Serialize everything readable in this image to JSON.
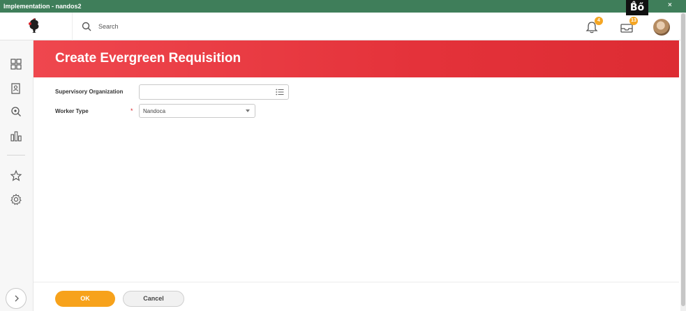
{
  "window": {
    "title": "Implementation - nandos2",
    "close_glyph": "×",
    "overlay_badge": "B̊ő"
  },
  "header": {
    "search_placeholder": "Search",
    "notifications": {
      "icon": "bell-icon",
      "count": "4"
    },
    "inbox": {
      "icon": "inbox-icon",
      "count": "13"
    },
    "avatar": "user-avatar"
  },
  "sidebar": {
    "items": [
      {
        "icon": "apps-grid-icon"
      },
      {
        "icon": "profile-card-icon"
      },
      {
        "icon": "search-zoom-icon"
      },
      {
        "icon": "bar-chart-icon"
      },
      {
        "icon": "star-icon"
      },
      {
        "icon": "gear-icon"
      }
    ],
    "expand_icon": "chevron-right-icon"
  },
  "page": {
    "title": "Create Evergreen Requisition"
  },
  "form": {
    "supervisory_org_label": "Supervisory Organization",
    "supervisory_org_value": "",
    "worker_type_label": "Worker Type",
    "required_marker": "*",
    "worker_type_value": "Nandoca"
  },
  "footer": {
    "ok_label": "OK",
    "cancel_label": "Cancel"
  },
  "colors": {
    "banner": "#e4323a",
    "accent": "#f7a21b",
    "titlebar": "#3f7e5a",
    "badge": "#f5a623"
  }
}
